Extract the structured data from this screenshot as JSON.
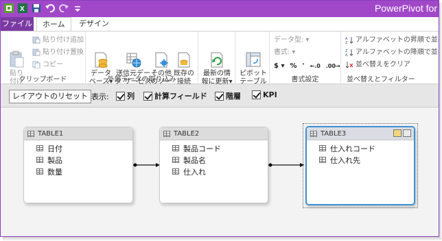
{
  "title": "PowerPivot for",
  "tabs": [
    {
      "label": "ファイル"
    },
    {
      "label": "ホーム"
    },
    {
      "label": "デザイン"
    }
  ],
  "ribbon": {
    "clipboard": {
      "label": "クリップボード",
      "paste": "貼り\n付け",
      "paste_append": "貼り付け追加",
      "paste_replace": "貼り付け置換",
      "copy": "コピー"
    },
    "external": {
      "label": "外部データの取り込み",
      "database": "データ\nベース▾",
      "data_service": "送信元デー\nタ サービス▾",
      "other_sources": "その他\nのソース",
      "existing": "既存の\n接続"
    },
    "refresh": {
      "label": "最新の情\n報に更新▾"
    },
    "pivot": {
      "label": "ピボット\nテーブル▾"
    },
    "format": {
      "label": "書式設定",
      "data_type": "データ型:",
      "format": "書式:",
      "symbols": [
        "$ ▾",
        "%",
        "'",
        "←.0",
        ".00→"
      ]
    },
    "sort": {
      "label": "並べ替えとフィルター",
      "sort_asc": "アルファベットの昇順で並べ替え",
      "sort_desc": "アルファベットの降順で並べ替え",
      "clear_sort": "並べ替えをクリア"
    }
  },
  "diagram_toolbar": {
    "reset_layout": "レイアウトのリセット",
    "show": "表示:",
    "checks": [
      {
        "label": "列",
        "checked": true
      },
      {
        "label": "計算フィールド",
        "checked": true
      },
      {
        "label": "階層",
        "checked": true
      },
      {
        "label": "KPI",
        "checked": true
      }
    ]
  },
  "tables": [
    {
      "name": "TABLE1",
      "columns": [
        "日付",
        "製品",
        "数量"
      ]
    },
    {
      "name": "TABLE2",
      "columns": [
        "製品コード",
        "製品名",
        "仕入れ"
      ]
    },
    {
      "name": "TABLE3",
      "columns": [
        "仕入れコード",
        "仕入れ先"
      ],
      "selected": true
    }
  ],
  "colors": {
    "titlebar": "#a148c9",
    "file_tab": "#7b3aa3",
    "selection": "#3d8fd6"
  }
}
